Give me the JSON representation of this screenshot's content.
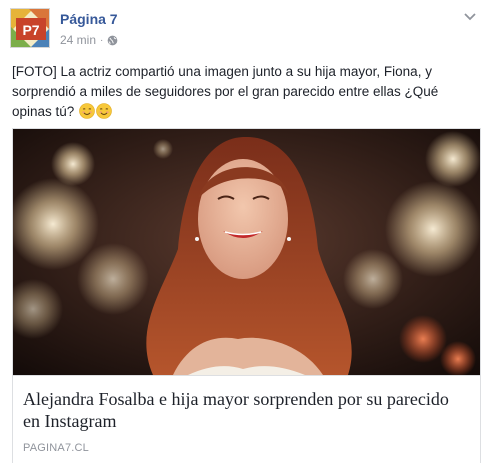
{
  "post": {
    "page_name": "Página 7",
    "timestamp": "24 min",
    "separator": "·",
    "avatar_text": "P7",
    "privacy_icon": "globe-icon",
    "menu_icon": "chevron-down-icon",
    "text": "[FOTO] La actriz compartió una imagen junto a su hija mayor, Fiona, y sorprendió a miles de seguidores por el gran parecido entre ellas ¿Qué opinas tú?",
    "emojis": [
      "smiling-face-emoji",
      "smiling-face-emoji"
    ]
  },
  "link": {
    "title": "Alejandra Fosalba e hija mayor sorprenden por su parecido en Instagram",
    "domain": "PAGINA7.CL"
  },
  "colors": {
    "link_blue": "#365899",
    "meta_gray": "#90949c",
    "border": "#dddfe2",
    "avatar_red": "#c8432a"
  }
}
